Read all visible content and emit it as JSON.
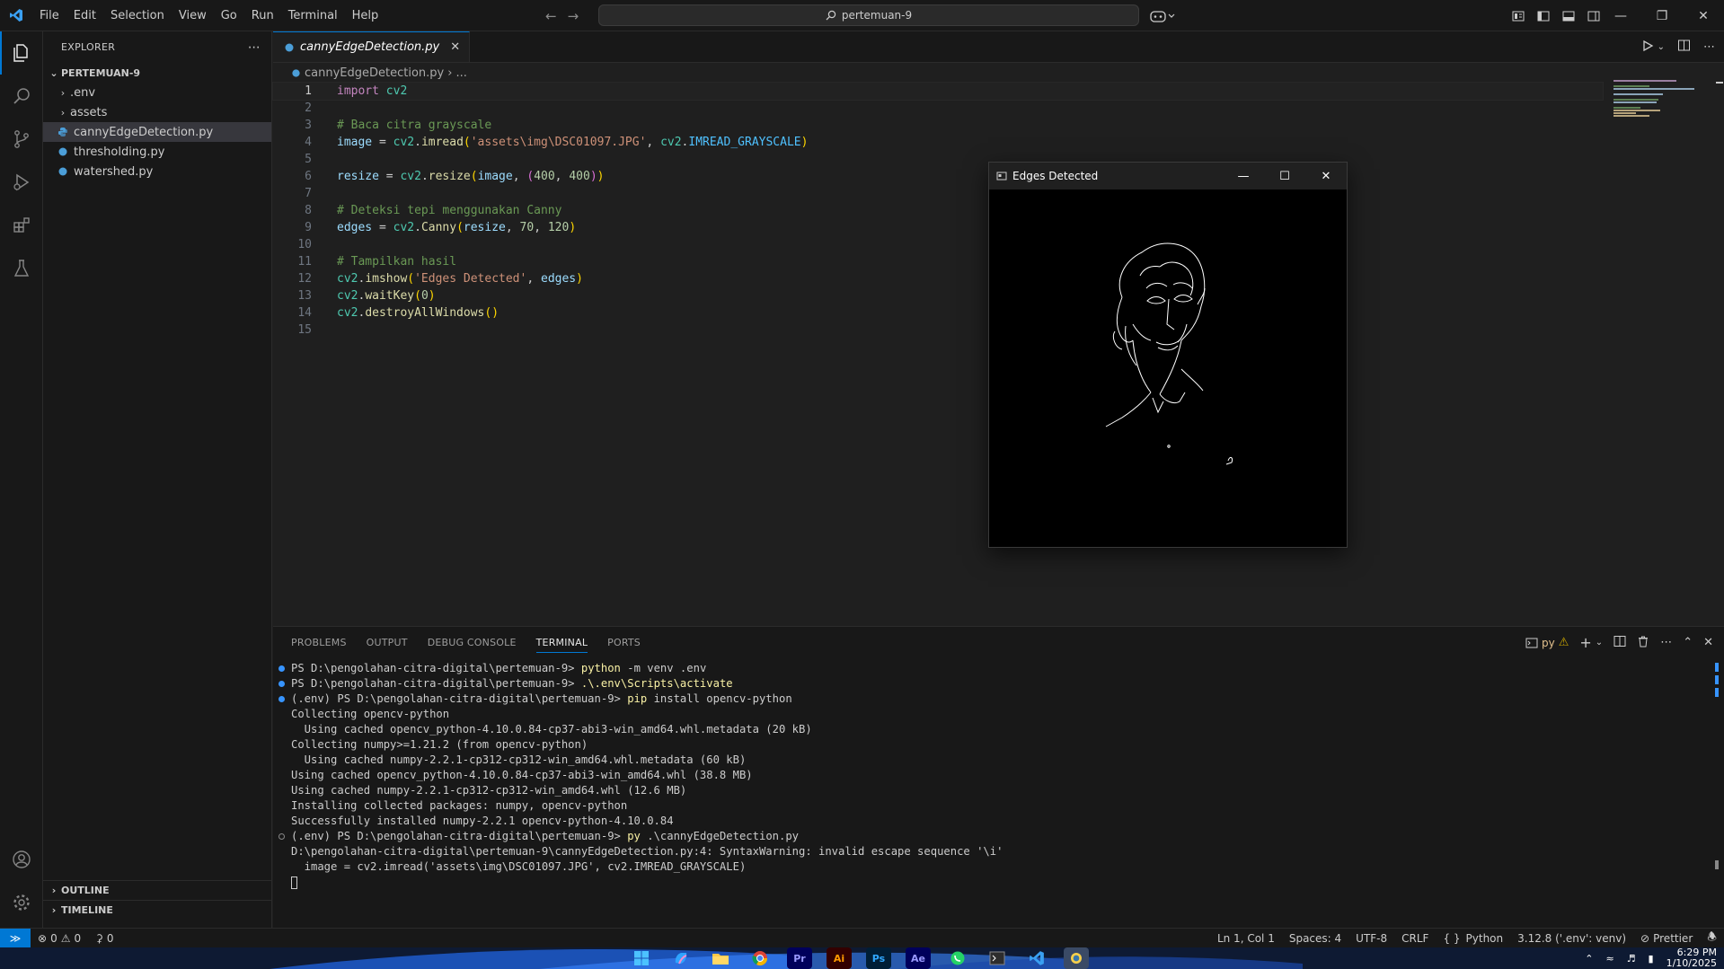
{
  "titlebar": {
    "menu": [
      "File",
      "Edit",
      "Selection",
      "View",
      "Go",
      "Run",
      "Terminal",
      "Help"
    ],
    "search_text": "pertemuan-9"
  },
  "sidebar": {
    "title": "EXPLORER",
    "folder": "PERTEMUAN-9",
    "items": [
      {
        "label": ".env",
        "type": "folder"
      },
      {
        "label": "assets",
        "type": "folder"
      },
      {
        "label": "cannyEdgeDetection.py",
        "type": "file"
      },
      {
        "label": "thresholding.py",
        "type": "file"
      },
      {
        "label": "watershed.py",
        "type": "file"
      }
    ],
    "outline_label": "OUTLINE",
    "timeline_label": "TIMELINE"
  },
  "editor": {
    "tab_label": "cannyEdgeDetection.py",
    "breadcrumb": [
      "cannyEdgeDetection.py",
      "..."
    ],
    "current_line": 1,
    "line_numbers": [
      "1",
      "2",
      "3",
      "4",
      "5",
      "6",
      "7",
      "8",
      "9",
      "10",
      "11",
      "12",
      "13",
      "14",
      "15"
    ]
  },
  "cv_window": {
    "title": "Edges Detected"
  },
  "panel": {
    "tabs": [
      "PROBLEMS",
      "OUTPUT",
      "DEBUG CONSOLE",
      "TERMINAL",
      "PORTS"
    ],
    "active_tab": "TERMINAL",
    "terminal_profile": "py",
    "lines": [
      {
        "dot": "blue",
        "prefix": "PS D:\\pengolahan-citra-digital\\pertemuan-9> ",
        "cmd": "python",
        "args": " -m venv .env"
      },
      {
        "dot": "blue",
        "prefix": "PS D:\\pengolahan-citra-digital\\pertemuan-9> ",
        "cmd": ".\\.env\\Scripts\\activate",
        "args": ""
      },
      {
        "dot": "blue",
        "prefix": "(.env) PS D:\\pengolahan-citra-digital\\pertemuan-9> ",
        "cmd": "pip",
        "args": " install opencv-python"
      },
      {
        "dot": "",
        "prefix": "Collecting opencv-python",
        "cmd": "",
        "args": ""
      },
      {
        "dot": "",
        "prefix": "  Using cached opencv_python-4.10.0.84-cp37-abi3-win_amd64.whl.metadata (20 kB)",
        "cmd": "",
        "args": ""
      },
      {
        "dot": "",
        "prefix": "Collecting numpy>=1.21.2 (from opencv-python)",
        "cmd": "",
        "args": ""
      },
      {
        "dot": "",
        "prefix": "  Using cached numpy-2.2.1-cp312-cp312-win_amd64.whl.metadata (60 kB)",
        "cmd": "",
        "args": ""
      },
      {
        "dot": "",
        "prefix": "Using cached opencv_python-4.10.0.84-cp37-abi3-win_amd64.whl (38.8 MB)",
        "cmd": "",
        "args": ""
      },
      {
        "dot": "",
        "prefix": "Using cached numpy-2.2.1-cp312-cp312-win_amd64.whl (12.6 MB)",
        "cmd": "",
        "args": ""
      },
      {
        "dot": "",
        "prefix": "Installing collected packages: numpy, opencv-python",
        "cmd": "",
        "args": ""
      },
      {
        "dot": "",
        "prefix": "Successfully installed numpy-2.2.1 opencv-python-4.10.0.84",
        "cmd": "",
        "args": ""
      },
      {
        "dot": "hollow",
        "prefix": "(.env) PS D:\\pengolahan-citra-digital\\pertemuan-9> ",
        "cmd": "py",
        "args": " .\\cannyEdgeDetection.py"
      },
      {
        "dot": "",
        "prefix": "D:\\pengolahan-citra-digital\\pertemuan-9\\cannyEdgeDetection.py:4: SyntaxWarning: invalid escape sequence '\\i'",
        "cmd": "",
        "args": ""
      },
      {
        "dot": "",
        "prefix": "  image = cv2.imread('assets\\img\\DSC01097.JPG', cv2.IMREAD_GRAYSCALE)",
        "cmd": "",
        "args": ""
      }
    ]
  },
  "statusbar": {
    "errors": "0",
    "warnings": "0",
    "ports": "0",
    "position": "Ln 1, Col 1",
    "spaces": "Spaces: 4",
    "encoding": "UTF-8",
    "eol": "CRLF",
    "language": "Python",
    "interpreter": "3.12.8 ('.env': venv)",
    "formatter": "Prettier"
  },
  "taskbar": {
    "time": "6:29 PM",
    "date": "1/10/2025",
    "apps": [
      "Pr",
      "Ai",
      "Ps",
      "Ae"
    ]
  },
  "colors": {
    "accent": "#0078d4",
    "editor_bg": "#1f1f1f",
    "chrome_bg": "#181818"
  }
}
